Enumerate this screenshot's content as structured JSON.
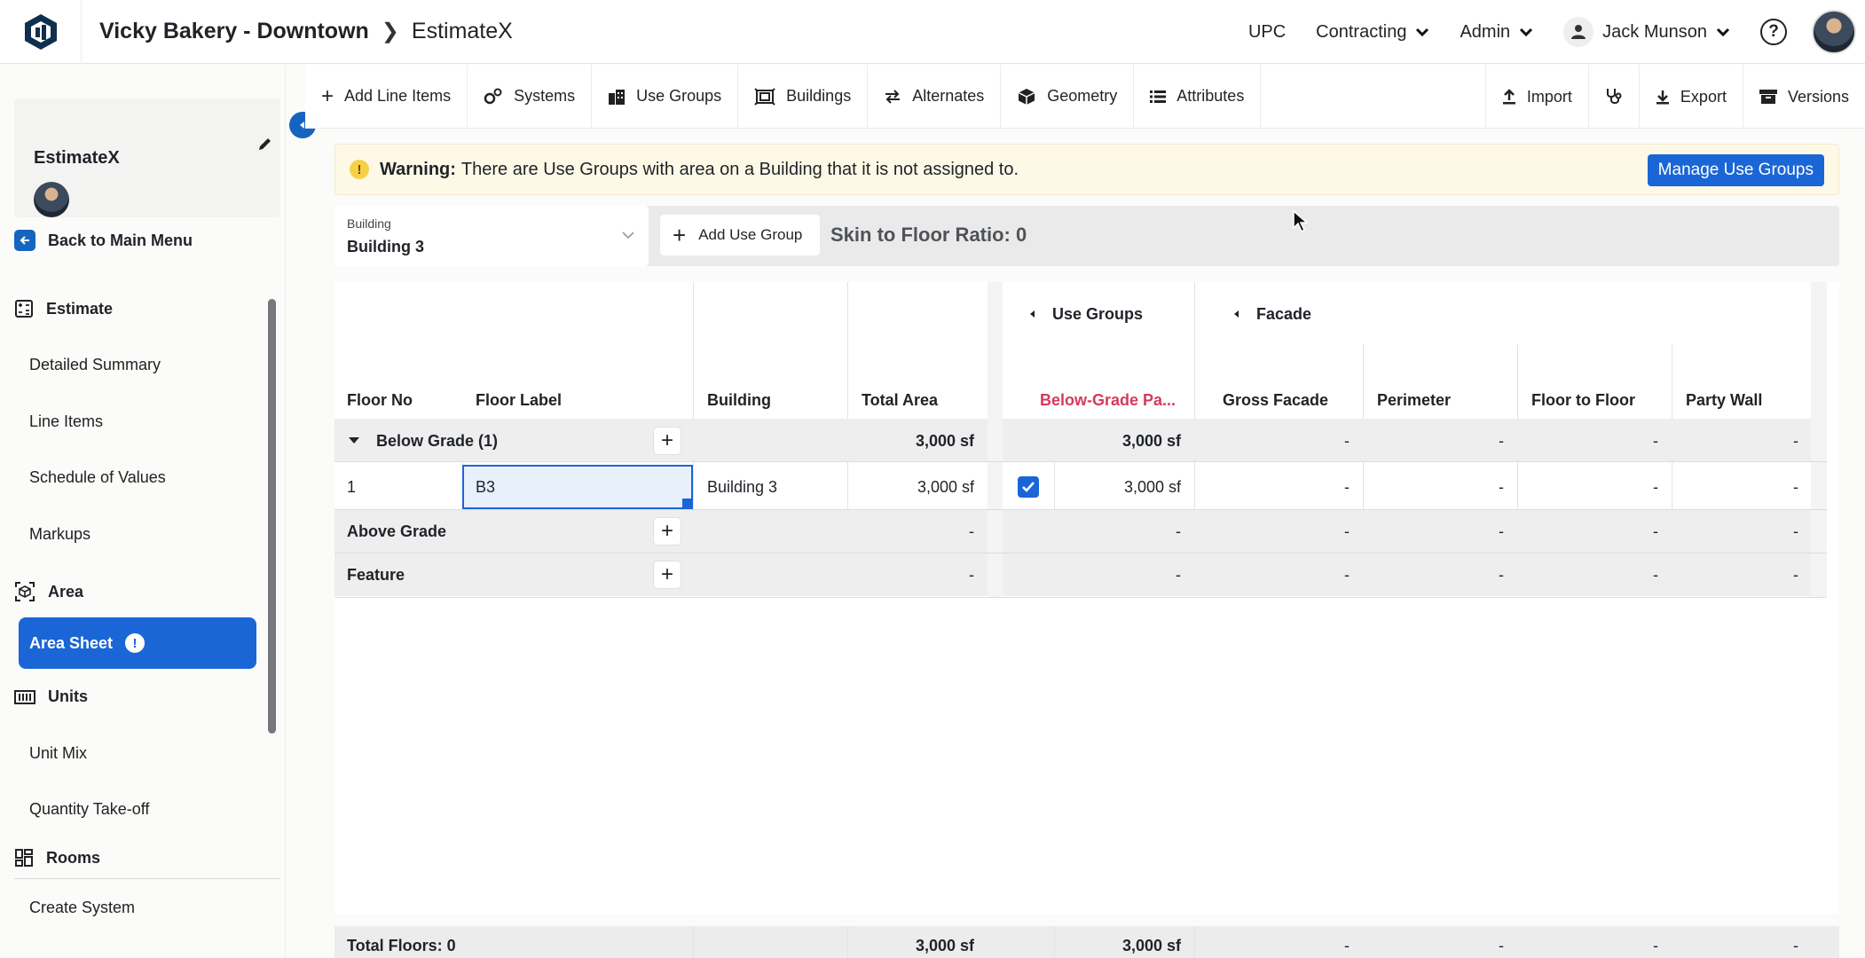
{
  "header": {
    "project": "Vicky Bakery - Downtown",
    "app": "EstimateX",
    "upc": "UPC",
    "contracting": "Contracting",
    "admin": "Admin",
    "user": "Jack Munson",
    "help": "?"
  },
  "sidebar": {
    "project_name": "EstimateX",
    "back": "Back to Main Menu",
    "estimate": "Estimate",
    "detailed_summary": "Detailed Summary",
    "line_items": "Line Items",
    "schedule_of_values": "Schedule of Values",
    "markups": "Markups",
    "area": "Area",
    "area_sheet": "Area Sheet",
    "area_sheet_alert": "!",
    "units": "Units",
    "unit_mix": "Unit Mix",
    "quantity_takeoff": "Quantity Take-off",
    "rooms": "Rooms",
    "create_system": "Create System"
  },
  "toolbar": {
    "add_line_items": "Add Line Items",
    "systems": "Systems",
    "use_groups": "Use Groups",
    "buildings": "Buildings",
    "alternates": "Alternates",
    "geometry": "Geometry",
    "attributes": "Attributes",
    "import": "Import",
    "export": "Export",
    "versions": "Versions"
  },
  "warning": {
    "label": "Warning:",
    "message": "There are Use Groups with area on a Building that it is not assigned to.",
    "button": "Manage Use Groups"
  },
  "filters": {
    "building_label": "Building",
    "building_value": "Building 3",
    "add_use_group": "Add Use Group",
    "skin_ratio": "Skin to Floor Ratio: 0"
  },
  "grid": {
    "group_use_groups": "Use Groups",
    "group_facade": "Facade",
    "columns": {
      "floor_no": "Floor No",
      "floor_label": "Floor Label",
      "building": "Building",
      "total_area": "Total Area",
      "below_grade": "Below-Grade Pa...",
      "gross_facade": "Gross Facade",
      "perimeter": "Perimeter",
      "floor_to_floor": "Floor to Floor",
      "party_wall": "Party Wall"
    },
    "below_grade_row": {
      "label": "Below Grade (1)",
      "total_area": "3,000 sf",
      "ug": "3,000 sf",
      "gross_facade": "-",
      "perimeter": "-",
      "floor_to_floor": "-",
      "party_wall": "-"
    },
    "row1": {
      "floor_no": "1",
      "floor_label": "B3",
      "building": "Building 3",
      "total_area": "3,000 sf",
      "ug": "3,000 sf",
      "gross_facade": "-",
      "perimeter": "-",
      "floor_to_floor": "-",
      "party_wall": "-"
    },
    "above_grade_row": {
      "label": "Above Grade",
      "total_area": "-",
      "ug": "-",
      "gross_facade": "-",
      "perimeter": "-",
      "floor_to_floor": "-",
      "party_wall": "-"
    },
    "feature_row": {
      "label": "Feature",
      "total_area": "-",
      "ug": "-",
      "gross_facade": "-",
      "perimeter": "-",
      "floor_to_floor": "-",
      "party_wall": "-"
    },
    "footer": {
      "total_floors": "Total Floors: 0",
      "total_area": "3,000 sf",
      "ug": "3,000 sf",
      "gross_facade": "-",
      "perimeter": "-",
      "floor_to_floor": "-",
      "party_wall": "-"
    }
  },
  "colors": {
    "accent": "#1a66d6",
    "warning_bg": "#fef9e7",
    "red_header": "#d63a5a"
  }
}
